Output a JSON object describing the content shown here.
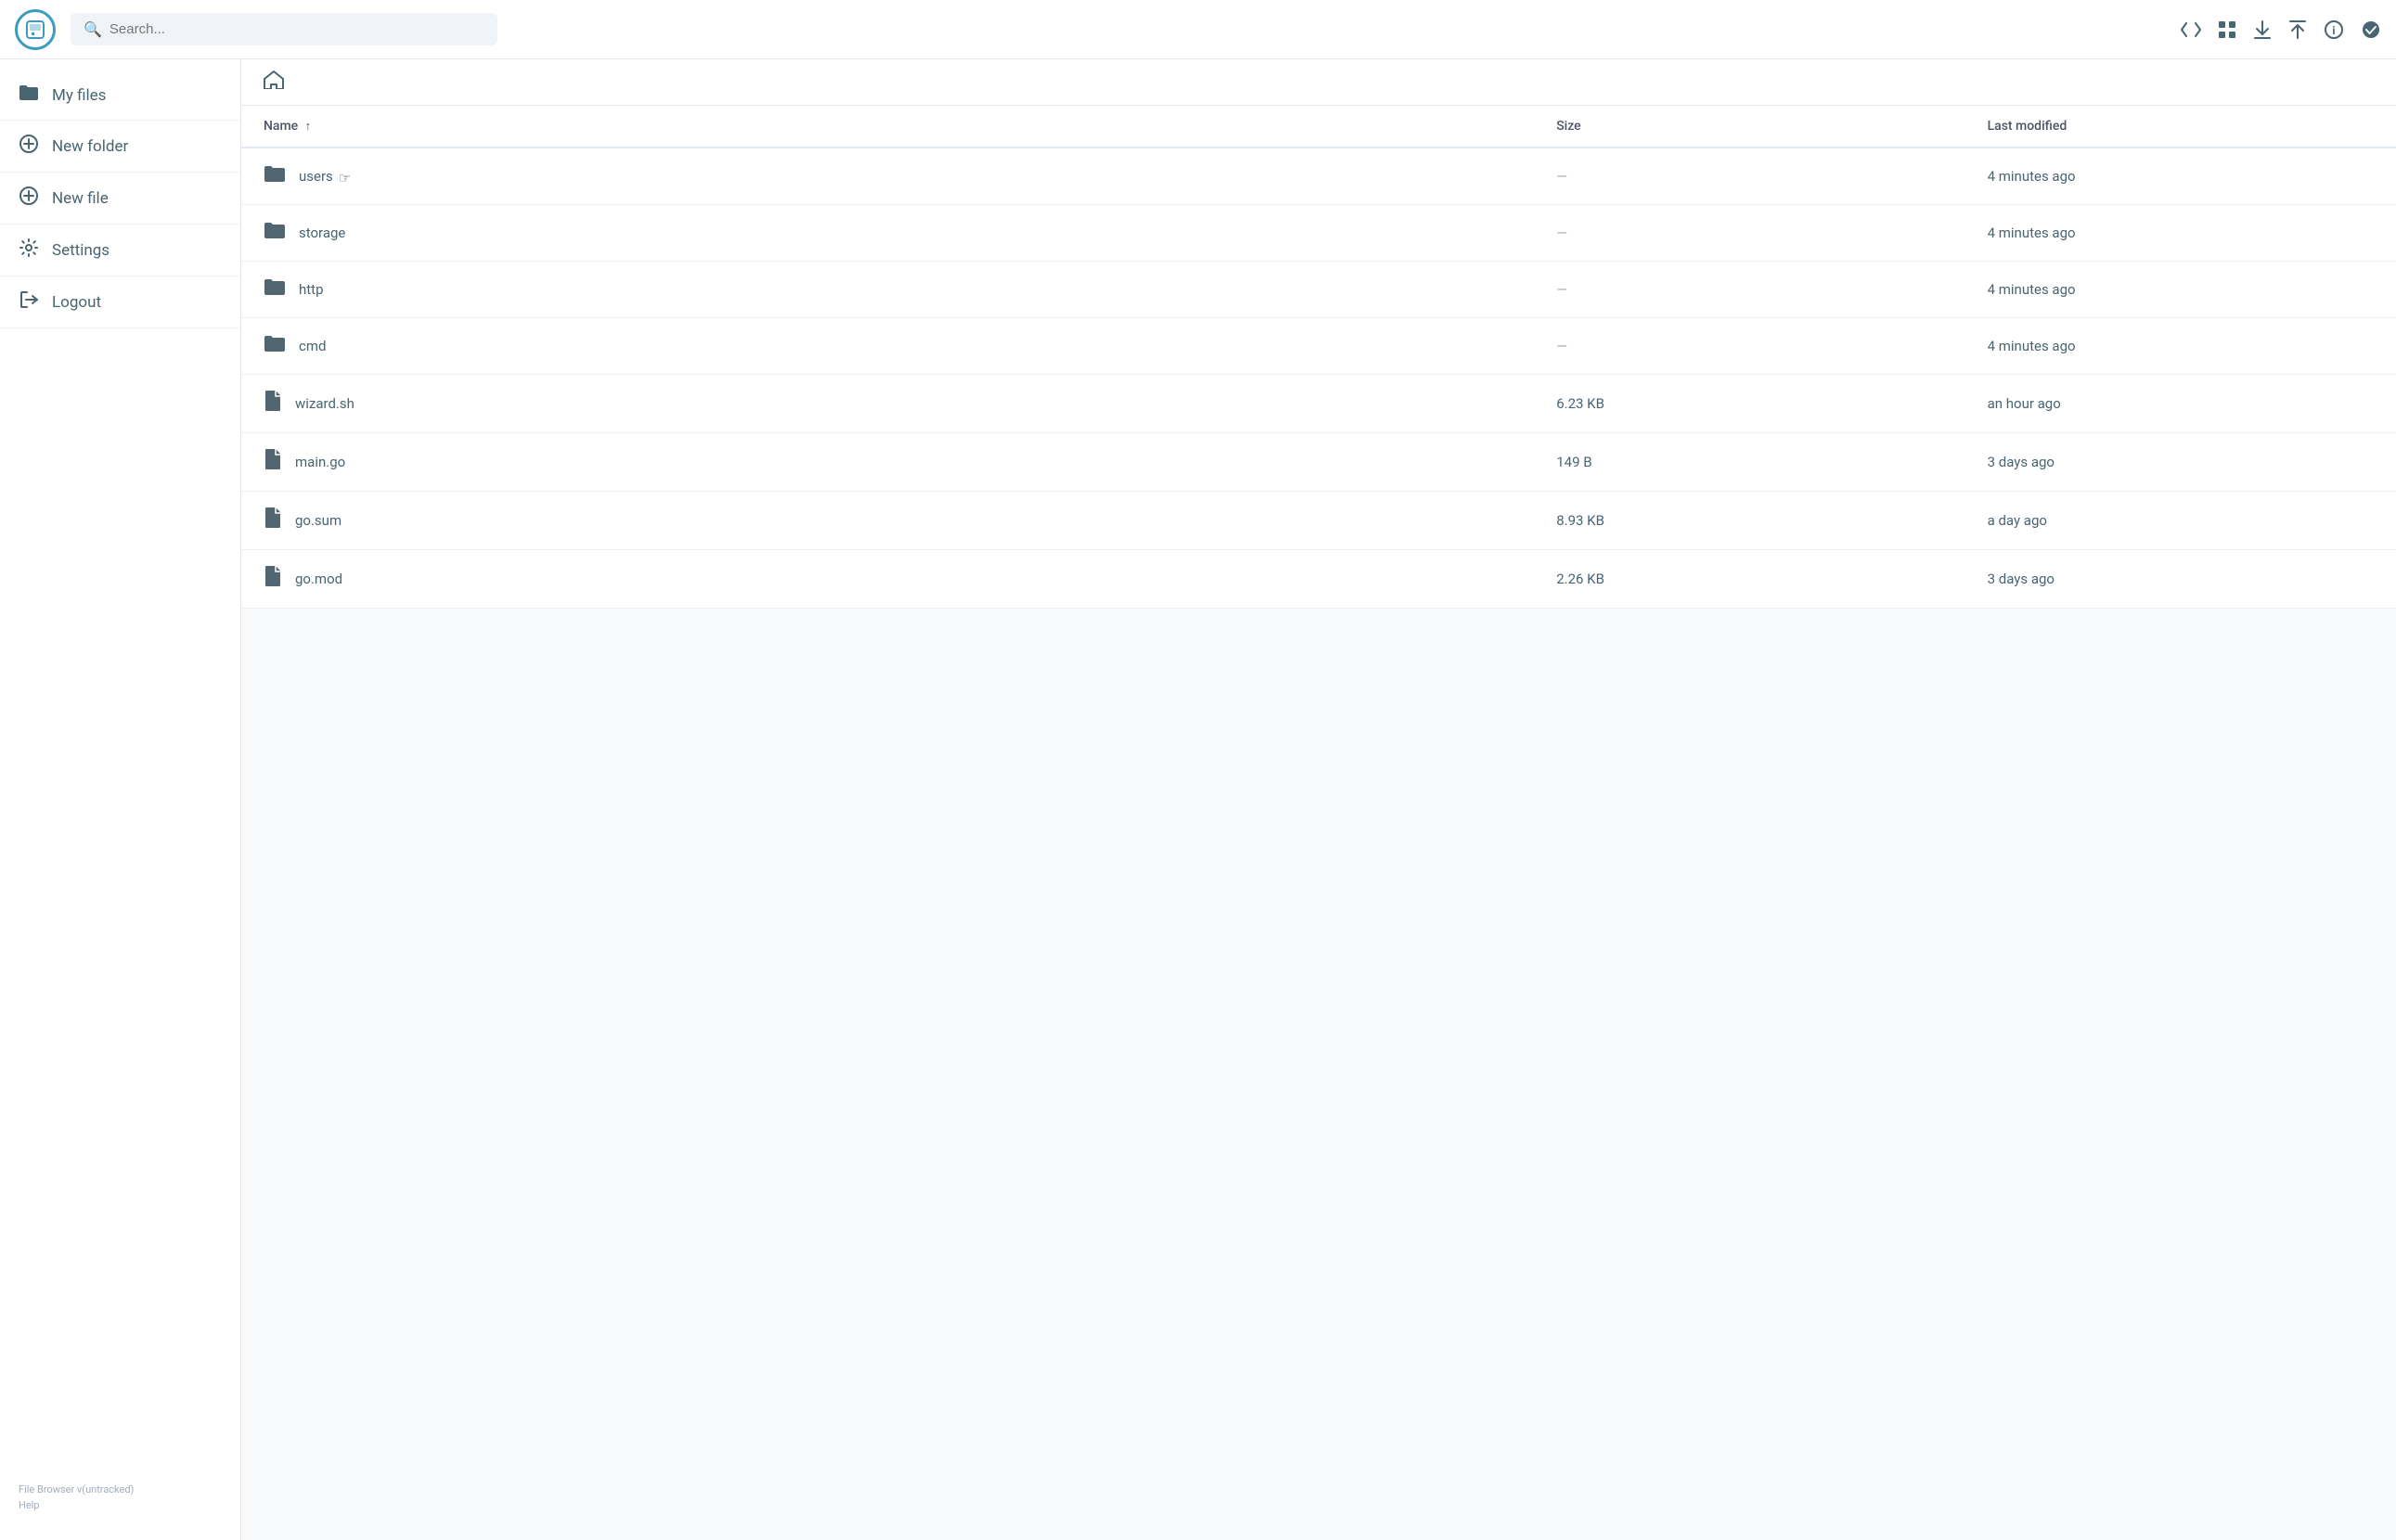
{
  "header": {
    "logo_symbol": "💾",
    "search_placeholder": "Search...",
    "actions": [
      {
        "name": "code-toggle-icon",
        "symbol": "<>"
      },
      {
        "name": "grid-view-icon",
        "symbol": "⊞"
      },
      {
        "name": "download-icon",
        "symbol": "↓"
      },
      {
        "name": "upload-icon",
        "symbol": "↑"
      },
      {
        "name": "info-icon",
        "symbol": "ℹ"
      },
      {
        "name": "checkmark-icon",
        "symbol": "✔"
      }
    ]
  },
  "sidebar": {
    "items": [
      {
        "id": "my-files",
        "label": "My files",
        "icon": "📁"
      },
      {
        "id": "new-folder",
        "label": "New folder",
        "icon": "➕"
      },
      {
        "id": "new-file",
        "label": "New file",
        "icon": "➕"
      },
      {
        "id": "settings",
        "label": "Settings",
        "icon": "⚙"
      },
      {
        "id": "logout",
        "label": "Logout",
        "icon": "➡"
      }
    ],
    "footer": {
      "version": "File Browser v(untracked)",
      "help": "Help"
    }
  },
  "main": {
    "breadcrumb": "🏠",
    "table": {
      "columns": [
        "Name",
        "Size",
        "Last modified"
      ],
      "sort_column": "Name",
      "sort_direction": "asc",
      "rows": [
        {
          "name": "users",
          "type": "folder",
          "size": "—",
          "modified": "4 minutes ago"
        },
        {
          "name": "storage",
          "type": "folder",
          "size": "—",
          "modified": "4 minutes ago"
        },
        {
          "name": "http",
          "type": "folder",
          "size": "—",
          "modified": "4 minutes ago"
        },
        {
          "name": "cmd",
          "type": "folder",
          "size": "—",
          "modified": "4 minutes ago"
        },
        {
          "name": "wizard.sh",
          "type": "file",
          "size": "6.23 KB",
          "modified": "an hour ago"
        },
        {
          "name": "main.go",
          "type": "file",
          "size": "149 B",
          "modified": "3 days ago"
        },
        {
          "name": "go.sum",
          "type": "file",
          "size": "8.93 KB",
          "modified": "a day ago"
        },
        {
          "name": "go.mod",
          "type": "file",
          "size": "2.26 KB",
          "modified": "3 days ago"
        }
      ]
    }
  }
}
